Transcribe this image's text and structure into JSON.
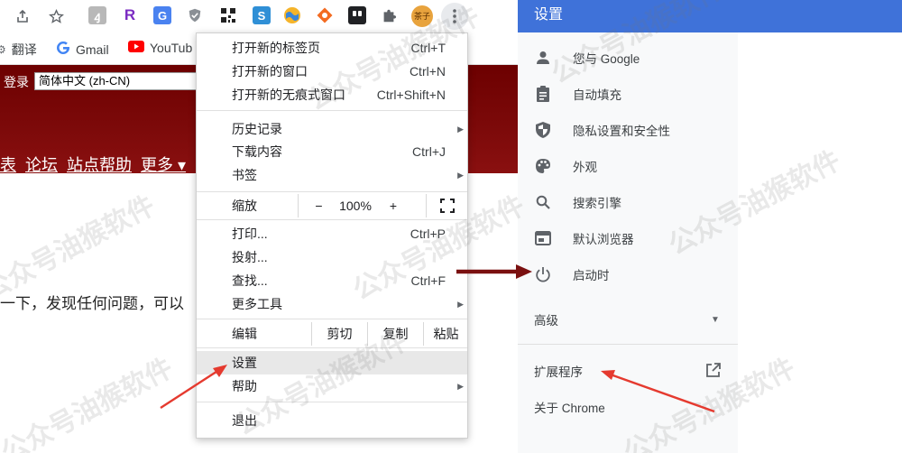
{
  "toolbar": {
    "extensions": [
      "share",
      "star",
      "hash-ext",
      "R",
      "translate-ext",
      "shield-ext",
      "qr-ext",
      "S",
      "globe-ext",
      "diamond-ext",
      "ghost-ext",
      "puzzle"
    ],
    "avatar_text": "茶子"
  },
  "bookmarks": {
    "items": [
      "翻译",
      "Gmail",
      "YouTub"
    ]
  },
  "page": {
    "login": "登录",
    "language": "简体中文 (zh-CN)",
    "nav": [
      "表",
      "论坛",
      "站点帮助",
      "更多 ▾"
    ],
    "body_text": "一下，发现任何问题，可以"
  },
  "menu": {
    "new_tab": "打开新的标签页",
    "new_tab_sc": "Ctrl+T",
    "new_window": "打开新的窗口",
    "new_window_sc": "Ctrl+N",
    "incognito": "打开新的无痕式窗口",
    "incognito_sc": "Ctrl+Shift+N",
    "history": "历史记录",
    "downloads": "下载内容",
    "downloads_sc": "Ctrl+J",
    "bookmarks": "书签",
    "zoom": "缩放",
    "zoom_minus": "−",
    "zoom_value": "100%",
    "zoom_plus": "+",
    "print": "打印...",
    "print_sc": "Ctrl+P",
    "cast": "投射...",
    "find": "查找...",
    "find_sc": "Ctrl+F",
    "more_tools": "更多工具",
    "edit": "编辑",
    "cut": "剪切",
    "copy": "复制",
    "paste": "粘贴",
    "settings": "设置",
    "help": "帮助",
    "exit": "退出"
  },
  "settings": {
    "title": "设置",
    "nav": {
      "you_and_google": "您与 Google",
      "autofill": "自动填充",
      "privacy": "隐私设置和安全性",
      "appearance": "外观",
      "search_engine": "搜索引擎",
      "default_browser": "默认浏览器",
      "on_startup": "启动时",
      "advanced": "高级",
      "extensions": "扩展程序",
      "about": "关于 Chrome"
    }
  },
  "watermark": "公众号油猴软件",
  "colors": {
    "settings_header": "#3f72d9",
    "page_header": "#7d0a0a",
    "arrow": "#e53a2f",
    "dark_arrow": "#7a1010"
  }
}
